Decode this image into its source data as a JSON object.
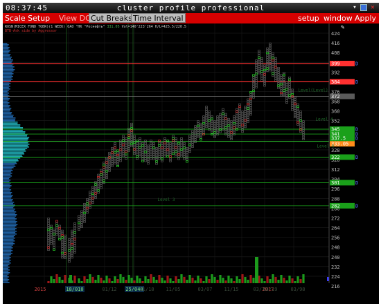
{
  "titlebar": {
    "clock": "08:37:45",
    "title": "cluster profile professional",
    "minimize_icon": "minimize-icon",
    "restore_icon": "restore-icon",
    "close_icon": "close-icon"
  },
  "menubar": {
    "scale_setup": "Scale Setup",
    "view_dom": "View DOM",
    "cut_breaks": "Cut Breaks",
    "time_interval": "Time Interval",
    "setup": "setup",
    "window": "window",
    "apply": "Apply"
  },
  "info": {
    "instrument": "ROSN(MICEX FOND TQBR)(1 WEEK) ОАО \"НК \"Роснефть\"",
    "price": "331.05",
    "stats": "Vol=140'223'264 H/L=425.5/220.5",
    "subtitle": "ВТВ-Ask side by Aggressor"
  },
  "colors": {
    "menu_red": "#d60000",
    "profile_blue": "#1e5fa0",
    "profile_cyan": "#1fa8b0",
    "red_level": "#ff3030",
    "green_level": "#1aa01a",
    "orange_level": "#ff8c1a",
    "grey_level": "#7a7a7a"
  },
  "price_axis": {
    "ticks": [
      "424",
      "416",
      "408",
      "400",
      "392",
      "384",
      "376",
      "368",
      "360",
      "352",
      "344",
      "336",
      "328",
      "320",
      "312",
      "304",
      "296",
      "288",
      "280",
      "272",
      "264",
      "256",
      "248",
      "240",
      "232",
      "224",
      "216"
    ],
    "labels": [
      {
        "text": "399",
        "color": "red"
      },
      {
        "text": "384",
        "color": "red"
      },
      {
        "text": "372",
        "color": "grey"
      },
      {
        "text": "345",
        "color": "green"
      },
      {
        "text": "341",
        "color": "green"
      },
      {
        "text": "333.05",
        "color": "orange"
      },
      {
        "text": "337.5",
        "color": "green"
      },
      {
        "text": "322",
        "color": "green"
      },
      {
        "text": "301",
        "color": "green"
      },
      {
        "text": "282",
        "color": "green"
      },
      {
        "text": "384",
        "color": "green"
      }
    ]
  },
  "level_labels": [
    {
      "text": "Level(Level)"
    },
    {
      "text": "Level 4"
    },
    {
      "text": "Level 6"
    },
    {
      "text": "Level 3"
    }
  ],
  "time_axis": {
    "labels": [
      "2015",
      "18/010",
      "01/12",
      "25/040",
      "11/18",
      "11/05",
      "03/07",
      "11/15",
      "03/19",
      "2017",
      "03/19",
      "03/98"
    ]
  }
}
